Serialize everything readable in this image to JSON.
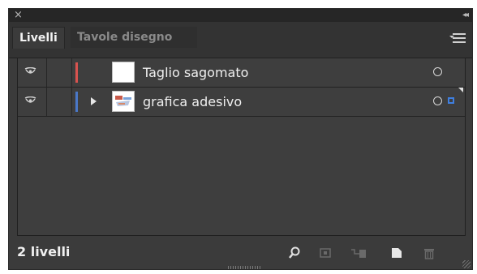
{
  "window": {
    "close_icon": "close-icon",
    "collapse_icon": "collapse-panel-icon"
  },
  "tabs": [
    {
      "label": "Livelli",
      "active": true
    },
    {
      "label": "Tavole disegno",
      "active": false
    }
  ],
  "panel_menu_icon": "panel-menu-icon",
  "layers": [
    {
      "name": "Taglio sagomato",
      "color": "#d9534f",
      "expandable": false,
      "visible": true,
      "selected": false
    },
    {
      "name": "grafica adesivo",
      "color": "#4a78c8",
      "expandable": true,
      "visible": true,
      "selected": true
    }
  ],
  "footer": {
    "count_label": "2 livelli",
    "icons": [
      "find-object-icon",
      "clipping-mask-icon",
      "new-sublayer-icon",
      "new-layer-icon",
      "delete-icon"
    ]
  },
  "colors": {
    "panel_bg": "#3b3b3b",
    "selection_square": "#3f7fe0"
  }
}
